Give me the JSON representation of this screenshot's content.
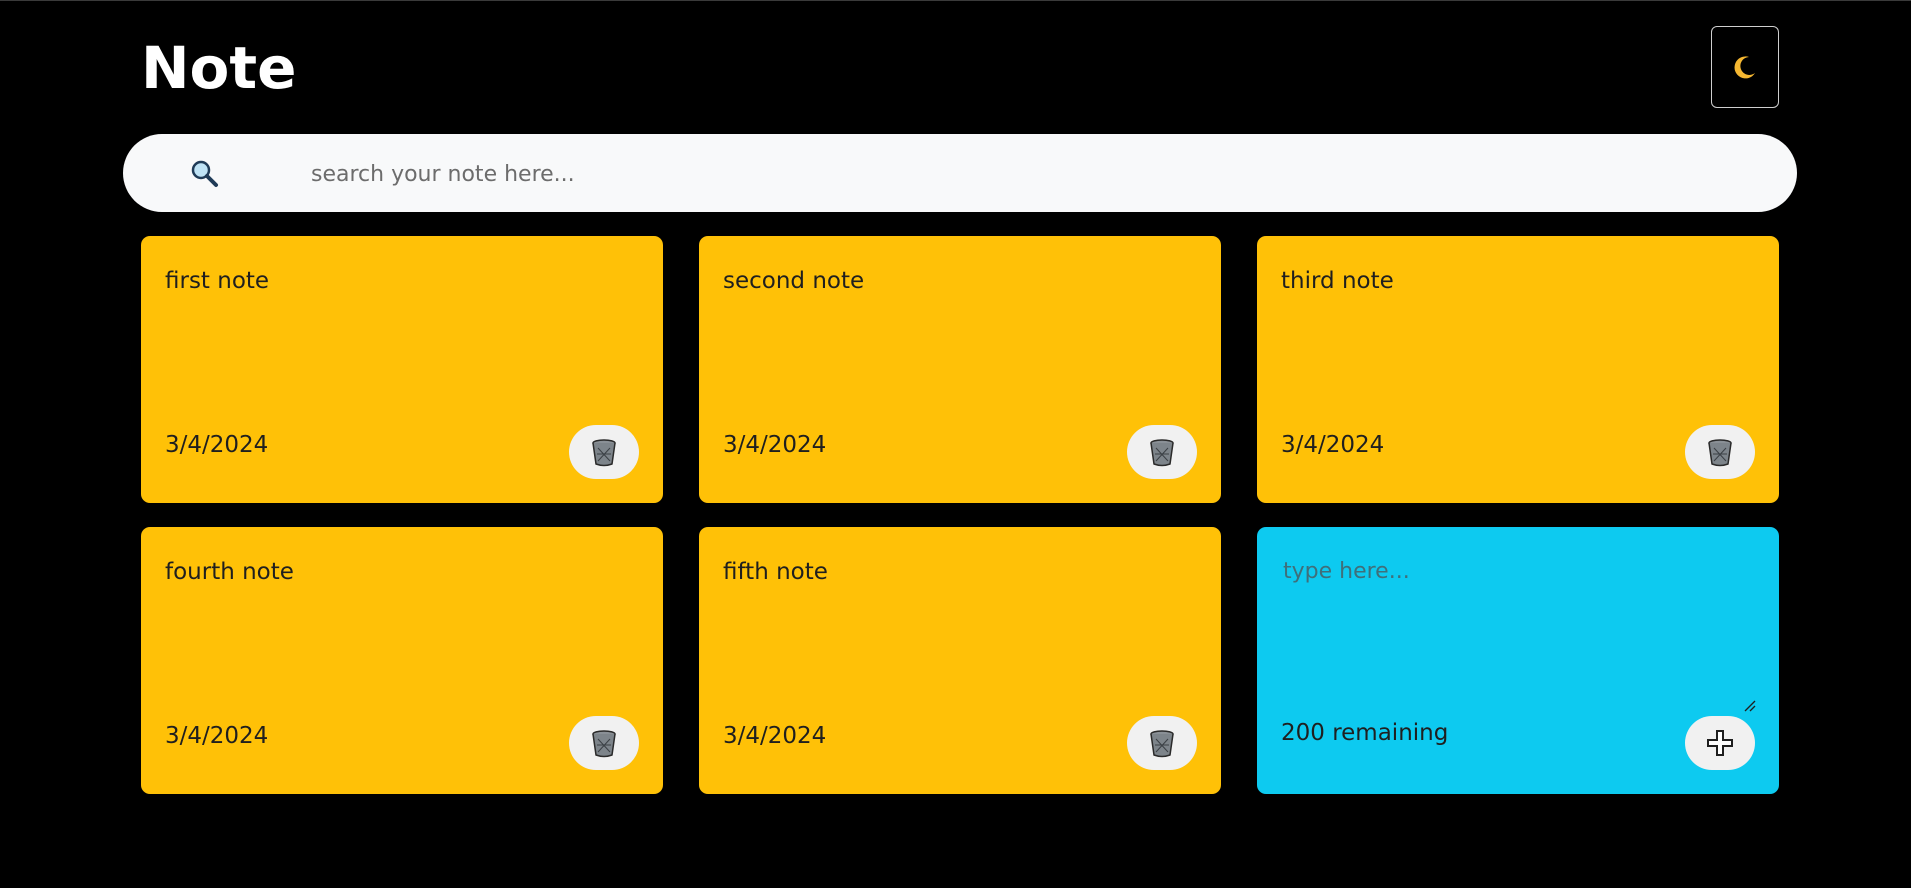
{
  "header": {
    "title": "Note",
    "theme_toggle_icon": "moon-icon"
  },
  "search": {
    "icon": "search-icon",
    "placeholder": "search your note here...",
    "value": ""
  },
  "notes": [
    {
      "text": "first note",
      "date": "3/4/2024",
      "delete_icon": "trash-icon"
    },
    {
      "text": "second note",
      "date": "3/4/2024",
      "delete_icon": "trash-icon"
    },
    {
      "text": "third note",
      "date": "3/4/2024",
      "delete_icon": "trash-icon"
    },
    {
      "text": "fourth note",
      "date": "3/4/2024",
      "delete_icon": "trash-icon"
    },
    {
      "text": "fifth note",
      "date": "3/4/2024",
      "delete_icon": "trash-icon"
    }
  ],
  "new_note": {
    "placeholder": "type here...",
    "value": "",
    "remaining": "200 remaining",
    "add_icon": "plus-icon"
  },
  "colors": {
    "background": "#000000",
    "note": "#ffc107",
    "new_note": "#0dcaf0",
    "search_bar": "#f8f9fa",
    "button": "#f1f1f1"
  }
}
